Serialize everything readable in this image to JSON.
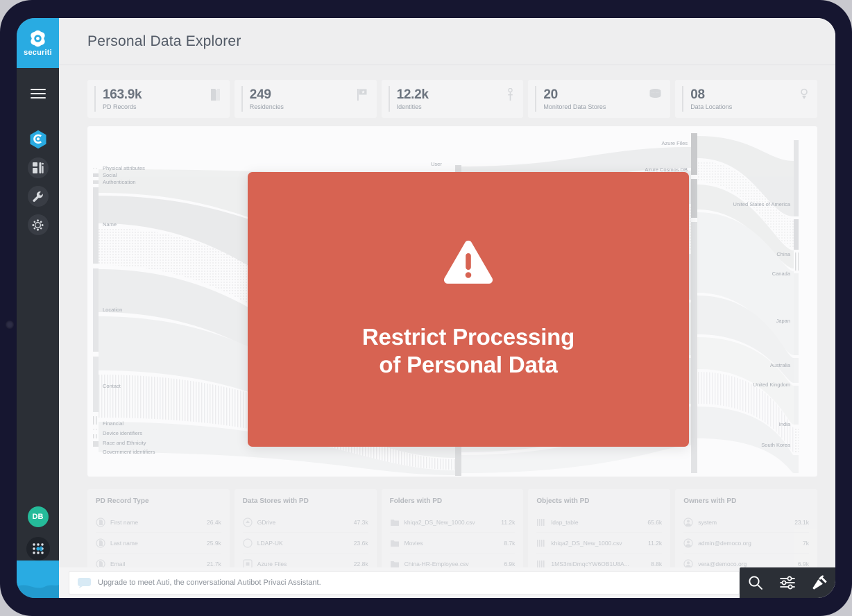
{
  "app": {
    "brand": "securiti",
    "page_title": "Personal Data Explorer"
  },
  "sidebar": {
    "logo_text": "securiti",
    "menu_icon": "hamburger-icon",
    "items": [
      {
        "name": "privaci-hub",
        "icon": "hexagon-shield-icon",
        "active": true
      },
      {
        "name": "dashboard",
        "icon": "dashboard-grid-icon",
        "active": false
      },
      {
        "name": "tools",
        "icon": "wrench-icon",
        "active": false
      },
      {
        "name": "settings",
        "icon": "gear-icon",
        "active": false
      }
    ],
    "avatar_initials": "DB",
    "apps_icon": "apps-grid-icon"
  },
  "stats": [
    {
      "value": "163.9k",
      "label": "PD Records",
      "icon": "pd-records-icon"
    },
    {
      "value": "249",
      "label": "Residencies",
      "icon": "flag-icon"
    },
    {
      "value": "12.2k",
      "label": "Identities",
      "icon": "identity-icon"
    },
    {
      "value": "20",
      "label": "Monitored Data Stores",
      "icon": "database-icon"
    },
    {
      "value": "08",
      "label": "Data Locations",
      "icon": "map-pin-icon"
    }
  ],
  "sankey": {
    "columns": {
      "category": [
        "Physical attributes",
        "Social",
        "Authentication",
        "Name",
        "Location",
        "Contact",
        "Financial",
        "Device identifiers",
        "Race and Ethnicity",
        "Government identifiers"
      ],
      "entity": [
        "User"
      ],
      "datastore": [
        "Azure Files",
        "Azure Cosmos DB"
      ],
      "country": [
        "United States of America",
        "China",
        "Canada",
        "Japan",
        "Australia",
        "United Kingdom",
        "India",
        "South Korea"
      ]
    }
  },
  "tables": [
    {
      "header": "PD Record Type",
      "icon": "record-icon",
      "rows": [
        {
          "name": "First name",
          "value": "26.4k"
        },
        {
          "name": "Last name",
          "value": "25.9k"
        },
        {
          "name": "Email",
          "value": "21.7k"
        }
      ]
    },
    {
      "header": "Data Stores with PD",
      "icon": "datastore-icon",
      "rows": [
        {
          "name": "GDrive",
          "value": "47.3k"
        },
        {
          "name": "LDAP-UK",
          "value": "23.6k"
        },
        {
          "name": "Azure Files",
          "value": "22.8k"
        }
      ]
    },
    {
      "header": "Folders with PD",
      "icon": "folder-icon",
      "rows": [
        {
          "name": "khiqa2_DS_New_1000.csv",
          "value": "11.2k"
        },
        {
          "name": "Movies",
          "value": "8.7k"
        },
        {
          "name": "China-HR-Employee.csv",
          "value": "6.9k"
        }
      ]
    },
    {
      "header": "Objects with PD",
      "icon": "object-icon",
      "rows": [
        {
          "name": "ldap_table",
          "value": "65.6k"
        },
        {
          "name": "khiqa2_DS_New_1000.csv",
          "value": "11.2k"
        },
        {
          "name": "1MS3miDmqcYW6OB1U8A...",
          "value": "8.8k"
        }
      ]
    },
    {
      "header": "Owners with PD",
      "icon": "owner-icon",
      "rows": [
        {
          "name": "system",
          "value": "23.1k"
        },
        {
          "name": "admin@democo.org",
          "value": "7k"
        },
        {
          "name": "vera@democo.org",
          "value": "6.9k"
        }
      ]
    }
  ],
  "assistant": {
    "placeholder": "Upgrade to meet Auti, the conversational Autibot Privaci Assistant.",
    "bubble_icon": "chat-bubble-icon"
  },
  "bottom_actions": [
    {
      "name": "search",
      "icon": "search-icon"
    },
    {
      "name": "filters",
      "icon": "sliders-icon"
    },
    {
      "name": "tools",
      "icon": "hammer-icon"
    }
  ],
  "modal": {
    "icon": "warning-triangle-icon",
    "title": "Restrict Processing\nof Personal Data",
    "background_color": "#D76352"
  },
  "colors": {
    "brand_cyan": "#29ABE2",
    "sidebar_dark": "#2B2F36",
    "bezel_navy": "#161630",
    "avatar_teal": "#25BB9A",
    "modal_red": "#D76352"
  }
}
